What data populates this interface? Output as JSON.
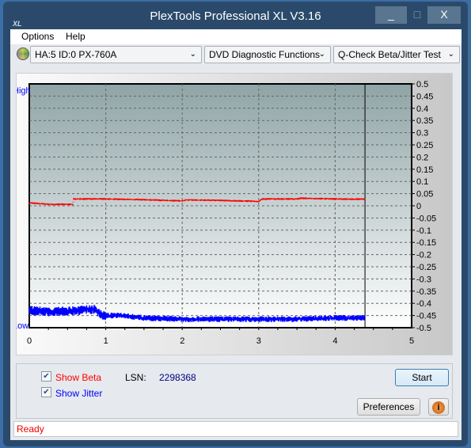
{
  "window": {
    "title": "PlexTools Professional XL V3.16",
    "icon": "XL",
    "minimize": "_",
    "maximize": "□",
    "close": "X"
  },
  "menu": {
    "items": [
      "Options",
      "Help"
    ]
  },
  "toolbar": {
    "drive": "HA:5 ID:0  PX-760A",
    "function": "DVD Diagnostic Functions",
    "test": "Q-Check Beta/Jitter Test"
  },
  "chart_data": {
    "type": "line",
    "left_labels": {
      "high": "High",
      "low": "Low"
    },
    "xlim": [
      0,
      5
    ],
    "ylim": [
      -0.5,
      0.5
    ],
    "x_ticks": [
      "0",
      "1",
      "2",
      "3",
      "4",
      "5"
    ],
    "y_ticks": [
      "0.5",
      "0.45",
      "0.4",
      "0.35",
      "0.3",
      "0.25",
      "0.2",
      "0.15",
      "0.1",
      "0.05",
      "0",
      "-0.05",
      "-0.1",
      "-0.15",
      "-0.2",
      "-0.25",
      "-0.3",
      "-0.35",
      "-0.4",
      "-0.45",
      "-0.5"
    ],
    "grid": true,
    "end_marker_x": 4.39,
    "series": [
      {
        "color": "#ff0000",
        "x": [
          0,
          0.25,
          0.57,
          0.58,
          1,
          1.5,
          2,
          2.05,
          2.5,
          3,
          3.05,
          3.5,
          3.55,
          4,
          4.39
        ],
        "y": [
          0.012,
          0.006,
          0.006,
          0.028,
          0.028,
          0.025,
          0.02,
          0.024,
          0.022,
          0.018,
          0.028,
          0.028,
          0.031,
          0.028,
          0.027
        ]
      },
      {
        "color": "#0000ff",
        "x": [
          0,
          0.3,
          0.6,
          0.85,
          0.95,
          1.2,
          1.5,
          2,
          2.5,
          3,
          3.5,
          4,
          4.39
        ],
        "y": [
          -0.43,
          -0.435,
          -0.43,
          -0.425,
          -0.45,
          -0.45,
          -0.46,
          -0.465,
          -0.465,
          -0.465,
          -0.465,
          -0.46,
          -0.46
        ]
      }
    ]
  },
  "options": {
    "show_beta": "Show Beta",
    "show_jitter": "Show Jitter",
    "beta_checked": true,
    "jitter_checked": true,
    "lsn_label": "LSN:",
    "lsn_value": "2298368"
  },
  "buttons": {
    "start": "Start",
    "preferences": "Preferences",
    "info": "i"
  },
  "status": "Ready"
}
